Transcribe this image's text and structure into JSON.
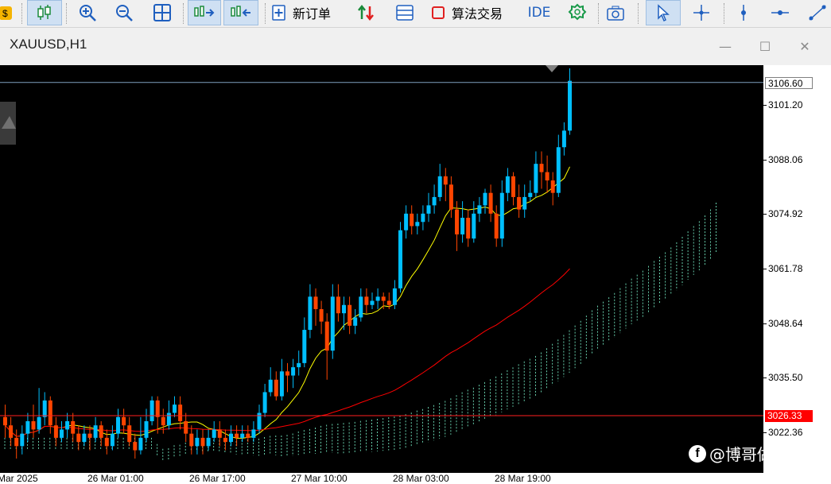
{
  "toolbar": {
    "new_order_label": "新订单",
    "algo_trading_label": "算法交易",
    "ide_label": "IDE"
  },
  "window": {
    "title": "XAUUSD,H1"
  },
  "price_axis": {
    "labels": [
      "3101.20",
      "3088.06",
      "3074.92",
      "3061.78",
      "3048.64",
      "3035.50",
      "3022.36"
    ],
    "current_high_label": "3106.60",
    "bid_label": "3026.33"
  },
  "time_axis": {
    "labels": [
      "Mar 2025",
      "26 Mar 01:00",
      "26 Mar 17:00",
      "27 Mar 10:00",
      "28 Mar 03:00",
      "28 Mar 19:00"
    ]
  },
  "watermark": {
    "text": "@博哥做黄金。"
  },
  "colors": {
    "up_candle": "#00bfff",
    "down_candle": "#ff4500",
    "ma_fast": "#ffff00",
    "ma_slow": "#ff0000",
    "cloud_upper": "#7fffd4",
    "cloud_lower": "#ff6347"
  },
  "chart_data": {
    "type": "candlestick",
    "symbol": "XAUUSD",
    "timeframe": "H1",
    "ylim": [
      3016,
      3110
    ],
    "high_line": 3106.6,
    "bid_line": 3026.33,
    "candles": [
      [
        3026,
        3024,
        3029,
        3021
      ],
      [
        3024,
        3021,
        3026,
        3019
      ],
      [
        3021,
        3019,
        3023,
        3016
      ],
      [
        3019,
        3022,
        3024,
        3017
      ],
      [
        3022,
        3025,
        3027,
        3020
      ],
      [
        3025,
        3023,
        3029,
        3021
      ],
      [
        3023,
        3026,
        3033,
        3022
      ],
      [
        3026,
        3030,
        3032,
        3024
      ],
      [
        3030,
        3024,
        3031,
        3022
      ],
      [
        3024,
        3021,
        3026,
        3019
      ],
      [
        3021,
        3023,
        3025,
        3020
      ],
      [
        3023,
        3025,
        3027,
        3021
      ],
      [
        3025,
        3022,
        3027,
        3020
      ],
      [
        3022,
        3020,
        3024,
        3018
      ],
      [
        3020,
        3022,
        3024,
        3019
      ],
      [
        3022,
        3021,
        3024,
        3018
      ],
      [
        3021,
        3024,
        3026,
        3020
      ],
      [
        3024,
        3021,
        3025,
        3019
      ],
      [
        3021,
        3019,
        3023,
        3017
      ],
      [
        3019,
        3022,
        3024,
        3018
      ],
      [
        3022,
        3026,
        3028,
        3021
      ],
      [
        3026,
        3024,
        3028,
        3022
      ],
      [
        3024,
        3020,
        3026,
        3019
      ],
      [
        3020,
        3018,
        3022,
        3016
      ],
      [
        3018,
        3021,
        3026,
        3017
      ],
      [
        3021,
        3025,
        3028,
        3020
      ],
      [
        3025,
        3030,
        3031,
        3024
      ],
      [
        3030,
        3026,
        3031,
        3022
      ],
      [
        3026,
        3024,
        3028,
        3022
      ],
      [
        3024,
        3027,
        3030,
        3023
      ],
      [
        3027,
        3029,
        3031,
        3026
      ],
      [
        3029,
        3025,
        3031,
        3023
      ],
      [
        3025,
        3022,
        3027,
        3020
      ],
      [
        3022,
        3019,
        3024,
        3017
      ],
      [
        3019,
        3021,
        3023,
        3017
      ],
      [
        3021,
        3019,
        3023,
        3017
      ],
      [
        3019,
        3021,
        3023,
        3018
      ],
      [
        3021,
        3023,
        3025,
        3020
      ],
      [
        3023,
        3021,
        3025,
        3019
      ],
      [
        3021,
        3020,
        3023,
        3018
      ],
      [
        3020,
        3022,
        3024,
        3019
      ],
      [
        3022,
        3021,
        3024,
        3019
      ],
      [
        3021,
        3022,
        3024,
        3020
      ],
      [
        3022,
        3021,
        3024,
        3020
      ],
      [
        3021,
        3023,
        3025,
        3020
      ],
      [
        3023,
        3027,
        3029,
        3022
      ],
      [
        3027,
        3032,
        3034,
        3026
      ],
      [
        3032,
        3035,
        3038,
        3031
      ],
      [
        3035,
        3031,
        3037,
        3030
      ],
      [
        3031,
        3037,
        3040,
        3030
      ],
      [
        3037,
        3036,
        3039,
        3032
      ],
      [
        3036,
        3038,
        3040,
        3033
      ],
      [
        3038,
        3039,
        3042,
        3036
      ],
      [
        3039,
        3047,
        3050,
        3038
      ],
      [
        3047,
        3055,
        3058,
        3045
      ],
      [
        3055,
        3052,
        3057,
        3048
      ],
      [
        3052,
        3049,
        3054,
        3046
      ],
      [
        3049,
        3042,
        3051,
        3035
      ],
      [
        3042,
        3055,
        3058,
        3040
      ],
      [
        3055,
        3051,
        3058,
        3049
      ],
      [
        3051,
        3053,
        3055,
        3047
      ],
      [
        3053,
        3048,
        3055,
        3046
      ],
      [
        3048,
        3050,
        3052,
        3046
      ],
      [
        3050,
        3055,
        3057,
        3049
      ],
      [
        3055,
        3053,
        3057,
        3051
      ],
      [
        3053,
        3054,
        3056,
        3052
      ],
      [
        3054,
        3055,
        3057,
        3052
      ],
      [
        3055,
        3054,
        3056,
        3052
      ],
      [
        3054,
        3053,
        3056,
        3052
      ],
      [
        3053,
        3057,
        3059,
        3052
      ],
      [
        3057,
        3071,
        3073,
        3056
      ],
      [
        3071,
        3075,
        3077,
        3069
      ],
      [
        3075,
        3072,
        3077,
        3070
      ],
      [
        3072,
        3073,
        3075,
        3070
      ],
      [
        3073,
        3075,
        3077,
        3071
      ],
      [
        3075,
        3077,
        3080,
        3073
      ],
      [
        3077,
        3079,
        3082,
        3075
      ],
      [
        3079,
        3084,
        3087,
        3078
      ],
      [
        3084,
        3082,
        3086,
        3078
      ],
      [
        3082,
        3076,
        3084,
        3074
      ],
      [
        3076,
        3070,
        3078,
        3066
      ],
      [
        3070,
        3074,
        3078,
        3068
      ],
      [
        3074,
        3069,
        3076,
        3067
      ],
      [
        3069,
        3075,
        3078,
        3068
      ],
      [
        3075,
        3077,
        3079,
        3073
      ],
      [
        3077,
        3080,
        3081,
        3075
      ],
      [
        3080,
        3075,
        3082,
        3073
      ],
      [
        3075,
        3069,
        3077,
        3067
      ],
      [
        3069,
        3080,
        3083,
        3067
      ],
      [
        3080,
        3084,
        3086,
        3078
      ],
      [
        3084,
        3079,
        3085,
        3077
      ],
      [
        3079,
        3076,
        3082,
        3074
      ],
      [
        3076,
        3079,
        3082,
        3074
      ],
      [
        3079,
        3080,
        3083,
        3078
      ],
      [
        3080,
        3087,
        3090,
        3079
      ],
      [
        3087,
        3085,
        3090,
        3081
      ],
      [
        3085,
        3083,
        3089,
        3080
      ],
      [
        3083,
        3080,
        3085,
        3077
      ],
      [
        3080,
        3091,
        3094,
        3079
      ],
      [
        3091,
        3095,
        3097,
        3089
      ],
      [
        3095,
        3107,
        3110,
        3094
      ]
    ]
  }
}
